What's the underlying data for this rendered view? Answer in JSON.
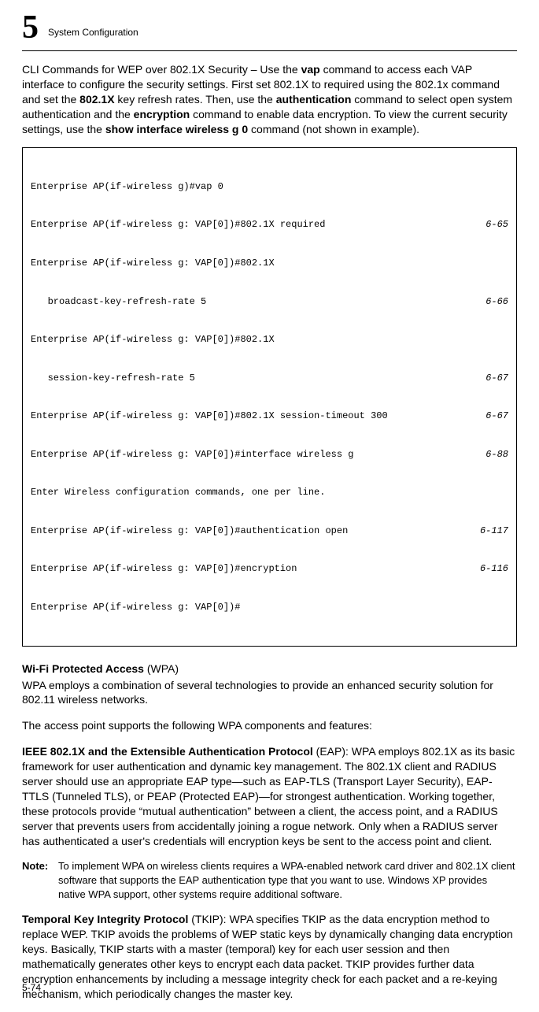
{
  "header": {
    "chapter_num": "5",
    "chapter_title": "System Configuration"
  },
  "intro": {
    "pre1": "CLI Commands for WEP over 802.1X Security – Use the ",
    "b1": "vap",
    "mid1": " command to access each VAP interface to configure the security settings. First set 802.1X to required using the 802.1x command and set the ",
    "b2": "802.1X",
    "mid2": " key refresh rates. Then, use the ",
    "b3": "authentication",
    "mid3": " command to select open system authentication and the ",
    "b4": "encryption",
    "mid4": " command to enable data encryption. To view the current security settings, use the ",
    "b5": "show interface wireless g 0",
    "post": " command (not shown in example)."
  },
  "code": {
    "lines": [
      {
        "cmd": "Enterprise AP(if-wireless g)#vap 0",
        "ref": ""
      },
      {
        "cmd": "Enterprise AP(if-wireless g: VAP[0])#802.1X required",
        "ref": "6-65"
      },
      {
        "cmd": "Enterprise AP(if-wireless g: VAP[0])#802.1X",
        "ref": ""
      },
      {
        "cmd": "   broadcast-key-refresh-rate 5",
        "ref": "6-66"
      },
      {
        "cmd": "Enterprise AP(if-wireless g: VAP[0])#802.1X",
        "ref": ""
      },
      {
        "cmd": "   session-key-refresh-rate 5",
        "ref": "6-67"
      },
      {
        "cmd": "Enterprise AP(if-wireless g: VAP[0])#802.1X session-timeout 300",
        "ref": "6-67"
      },
      {
        "cmd": "Enterprise AP(if-wireless g: VAP[0])#interface wireless g",
        "ref": "6-88"
      },
      {
        "cmd": "Enter Wireless configuration commands, one per line.",
        "ref": ""
      },
      {
        "cmd": "Enterprise AP(if-wireless g: VAP[0])#authentication open",
        "ref": "6-117"
      },
      {
        "cmd": "Enterprise AP(if-wireless g: VAP[0])#encryption",
        "ref": "6-116"
      },
      {
        "cmd": "Enterprise AP(if-wireless g: VAP[0])#",
        "ref": ""
      }
    ]
  },
  "wpa_heading": {
    "bold": "Wi-Fi Protected Access",
    "rest": " (WPA)"
  },
  "wpa_p1": "WPA employs a combination of several technologies to provide an enhanced security solution for 802.11 wireless networks.",
  "wpa_p2": "The access point supports the following WPA components and features:",
  "ieee": {
    "bold": "IEEE 802.1X and the Extensible Authentication Protocol",
    "rest": " (EAP): WPA employs 802.1X as its basic framework for user authentication and dynamic key management. The 802.1X client and RADIUS server should use an appropriate EAP type—such as EAP-TLS (Transport Layer Security), EAP-TTLS (Tunneled TLS), or PEAP (Protected EAP)—for strongest authentication. Working together, these protocols provide “mutual authentication” between a client, the access point, and a RADIUS server that prevents users from accidentally joining a rogue network. Only when a RADIUS server has authenticated a user's credentials will encryption keys be sent to the access point and client."
  },
  "note": {
    "label": "Note:",
    "text": "To implement WPA on wireless clients requires a WPA-enabled network card driver and 802.1X client software that supports the EAP authentication type that you want to use. Windows XP provides native WPA support, other systems require additional software."
  },
  "tkip": {
    "bold": "Temporal Key Integrity Protocol",
    "rest": " (TKIP): WPA specifies TKIP as the data encryption method to replace WEP. TKIP avoids the problems of WEP static keys by dynamically changing data encryption keys. Basically, TKIP starts with a master (temporal) key for each user session and then mathematically generates other keys to encrypt each data packet. TKIP provides further data encryption enhancements by including a message integrity check for each packet and a re-keying mechanism, which periodically changes the master key."
  },
  "page_num": "5-74"
}
